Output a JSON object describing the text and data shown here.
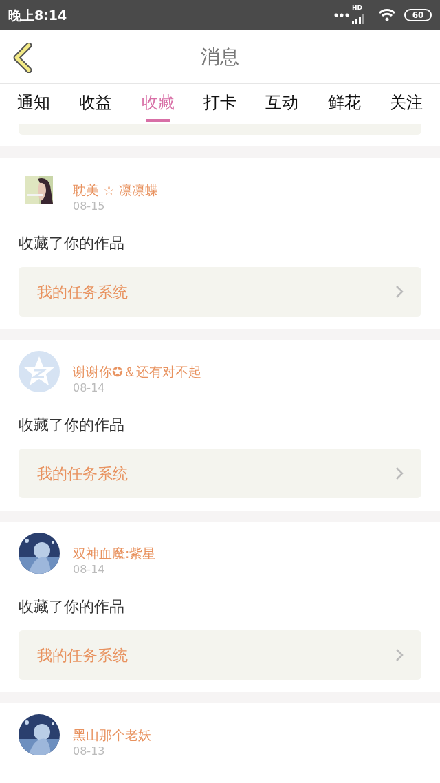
{
  "status_bar": {
    "time": "晚上8:14",
    "network": "HD",
    "battery": "60"
  },
  "header": {
    "title": "消息"
  },
  "tabs": [
    {
      "label": "通知",
      "selected": false
    },
    {
      "label": "收益",
      "selected": false
    },
    {
      "label": "收藏",
      "selected": true
    },
    {
      "label": "打卡",
      "selected": false
    },
    {
      "label": "互动",
      "selected": false
    },
    {
      "label": "鲜花",
      "selected": false
    },
    {
      "label": "关注",
      "selected": false
    }
  ],
  "messages": [
    {
      "kind": "square-photo",
      "name": "耽美 ☆ 凛凛蝶",
      "date": "08-15",
      "text": "收藏了你的作品",
      "link": "我的任务系统"
    },
    {
      "kind": "default",
      "name": "谢谢你✪＆还有对不起",
      "date": "08-14",
      "text": "收藏了你的作品",
      "link": "我的任务系统"
    },
    {
      "name": "双神血魔:紫星",
      "date": "08-14",
      "text": "收藏了你的作品",
      "link": "我的任务系统"
    },
    {
      "name": "黑山那个老妖",
      "date": "08-13"
    }
  ]
}
